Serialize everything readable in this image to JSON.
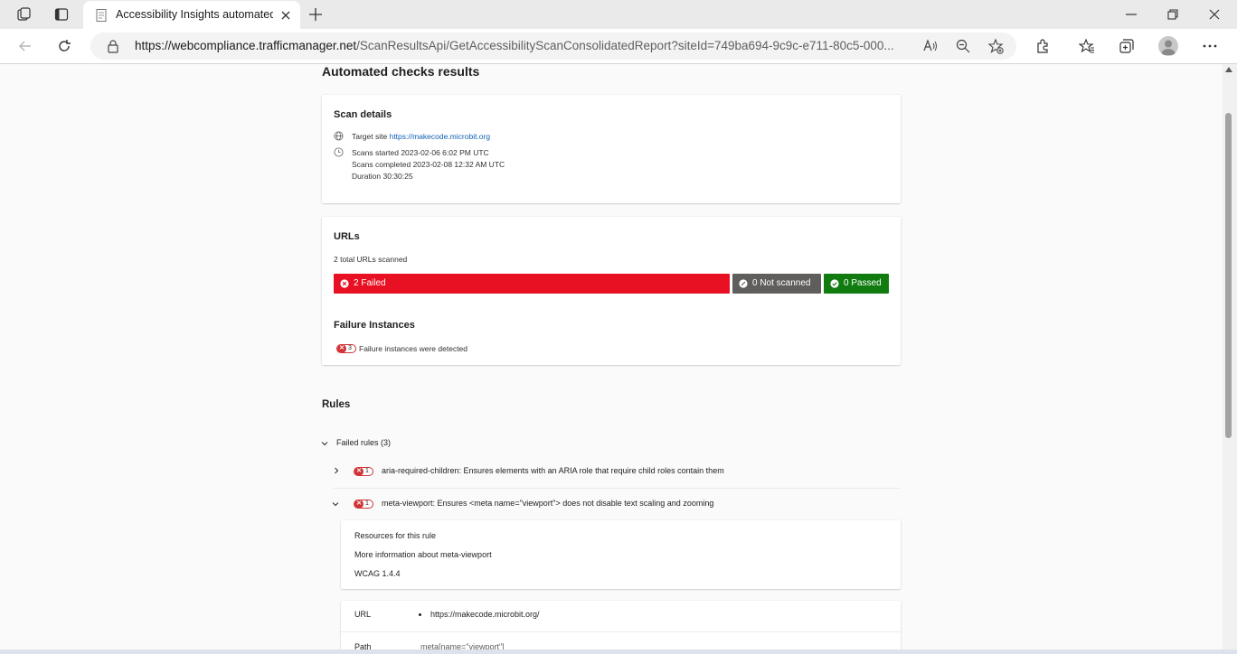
{
  "browser": {
    "tab_title": "Accessibility Insights automated",
    "url_host": "https://webcompliance.trafficmanager.net",
    "url_rest": "/ScanResultsApi/GetAccessibilityScanConsolidatedReport?siteId=749ba694-9c9c-e711-80c5-000...",
    "icons": [
      "workspaces-icon",
      "vertical-tabs-icon",
      "close-icon",
      "new-tab-icon",
      "minimize-icon",
      "restore-icon",
      "back-icon",
      "refresh-icon",
      "lock-icon",
      "read-aloud-icon",
      "zoom-icon",
      "add-favorite-icon",
      "extensions-icon",
      "favorites-icon",
      "collections-icon",
      "profile-icon",
      "more-icon"
    ]
  },
  "page": {
    "title": "Automated checks results",
    "scan_details": {
      "heading": "Scan details",
      "target_label": "Target site",
      "target_url": "https://makecode.microbit.org",
      "scans_started": "Scans started 2023-02-06 6:02 PM UTC",
      "scans_completed": "Scans completed 2023-02-08 12:32 AM UTC",
      "duration": "Duration 30:30:25"
    },
    "urls": {
      "heading": "URLs",
      "total": "2 total URLs scanned",
      "failed": "2 Failed",
      "not_scanned": "0 Not scanned",
      "passed": "0 Passed",
      "failed_count": 2,
      "not_scanned_count": 0,
      "passed_count": 0,
      "colors": {
        "failed": "#e81123",
        "not_scanned": "#605e5c",
        "passed": "#107c10"
      }
    },
    "failure_instances": {
      "heading": "Failure Instances",
      "count": "3",
      "text": "Failure instances were detected"
    },
    "rules": {
      "heading": "Rules",
      "failed_group": "Failed rules (3)",
      "items": [
        {
          "count": "1",
          "text": "aria-required-children: Ensures elements with an ARIA role that require child roles contain them",
          "expanded": false
        },
        {
          "count": "1",
          "text": "meta-viewport: Ensures <meta name=\"viewport\"> does not disable text scaling and zooming",
          "expanded": true
        }
      ],
      "resources": {
        "heading": "Resources for this rule",
        "more_info": "More information about meta-viewport",
        "wcag": "WCAG 1.4.4"
      },
      "instance": {
        "url_label": "URL",
        "url_value": "https://makecode.microbit.org/",
        "path_label": "Path",
        "path_value": "meta[name=\"viewport\"]"
      }
    }
  }
}
